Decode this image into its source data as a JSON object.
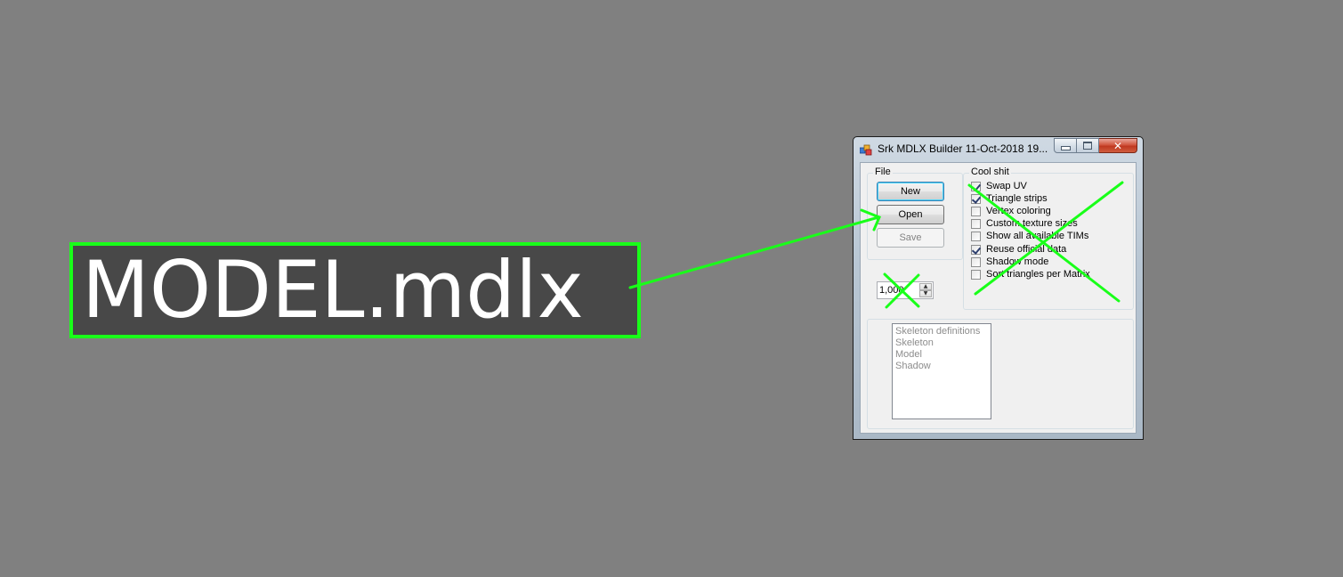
{
  "file_label": "MODEL.mdlx",
  "window": {
    "title": "Srk MDLX Builder 11-Oct-2018 19..."
  },
  "file_group": {
    "label": "File",
    "buttons": {
      "new": "New",
      "open": "Open",
      "save": "Save"
    }
  },
  "cool_group": {
    "label": "Cool shit",
    "options": [
      {
        "label": "Swap UV",
        "checked": true
      },
      {
        "label": "Triangle strips",
        "checked": true
      },
      {
        "label": "Vertex coloring",
        "checked": false
      },
      {
        "label": "Custom texture sizes",
        "checked": false
      },
      {
        "label": "Show all available TIMs",
        "checked": false
      },
      {
        "label": "Reuse official data",
        "checked": true
      },
      {
        "label": "Shadow mode",
        "checked": false
      },
      {
        "label": "Sort triangles per Matrix",
        "checked": false
      }
    ]
  },
  "numeric": {
    "value": "1,000"
  },
  "list": {
    "items": [
      "Skeleton definitions",
      "Skeleton",
      "Model",
      "Shadow"
    ]
  },
  "colors": {
    "background": "#808080",
    "annotation_green": "#19ff19",
    "label_bg": "#484848"
  },
  "icons": [
    "app-icon",
    "minimize-icon",
    "maximize-icon",
    "close-icon",
    "spin-up-icon",
    "spin-down-icon",
    "arrow-annotation",
    "cross-annotation"
  ]
}
